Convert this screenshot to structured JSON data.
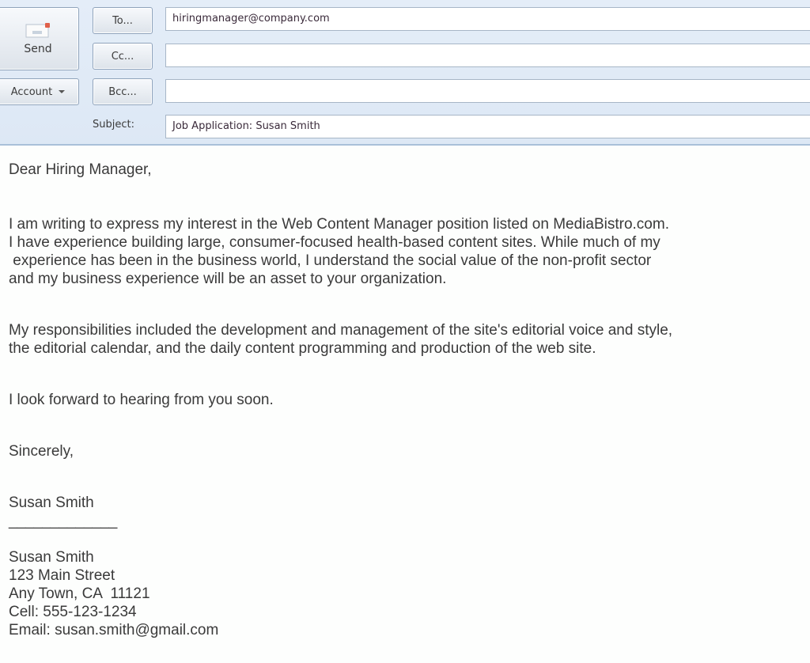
{
  "compose": {
    "send_label": "Send",
    "account_label": "Account",
    "to_label": "To...",
    "cc_label": "Cc...",
    "bcc_label": "Bcc...",
    "subject_label": "Subject:",
    "to_value": "hiringmanager@company.com",
    "cc_value": "",
    "bcc_value": "",
    "subject_value": "Job Application: Susan Smith"
  },
  "letter": {
    "greeting": "Dear Hiring Manager,",
    "paragraph1": [
      "I am writing to express my interest in the Web Content Manager position listed on MediaBistro.com.",
      "I have experience building large, consumer-focused health-based content sites. While much of my",
      " experience has been in the business world, I understand the social value of the non-profit sector",
      "and my business experience will be an asset to your organization."
    ],
    "paragraph2": [
      "My responsibilities included the development and management of the site's editorial voice and style,",
      "the editorial calendar, and the daily content programming and production of the web site."
    ],
    "closing_line": "I look forward to hearing from you soon.",
    "sign_off": "Sincerely,",
    "signature_name": "Susan Smith",
    "signature_rule": "_____________",
    "contact": {
      "name": "Susan Smith",
      "street": "123 Main Street",
      "city_line": "Any Town, CA  11121",
      "cell": "Cell: 555-123-1234",
      "email": "Email: susan.smith@gmail.com"
    }
  }
}
